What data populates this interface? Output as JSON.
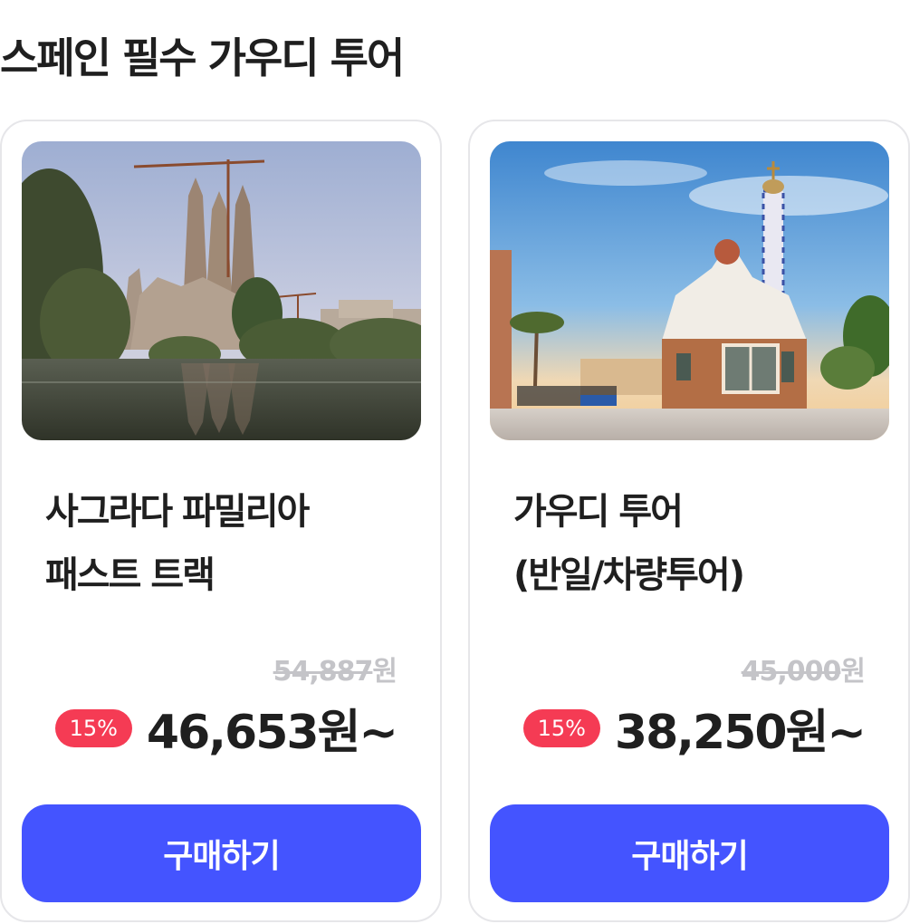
{
  "section": {
    "title": "스페인 필수 가우디 투어"
  },
  "products": [
    {
      "name_line1": "사그라다 파밀리아",
      "name_line2": "패스트 트랙",
      "original_price": "54,887",
      "original_unit": "원",
      "discount_badge": "15%",
      "price": "46,653원~",
      "buy_label": "구매하기",
      "image": "sagrada-familia-photo"
    },
    {
      "name_line1": "가우디 투어",
      "name_line2": "(반일/차량투어)",
      "original_price": "45,000",
      "original_unit": "원",
      "discount_badge": "15%",
      "price": "38,250원~",
      "buy_label": "구매하기",
      "image": "park-guell-house-photo"
    }
  ],
  "colors": {
    "accent": "#4454ff",
    "badge": "#f53b54",
    "strike_price": "#c4c4c8",
    "card_border": "#e6e6e9"
  }
}
